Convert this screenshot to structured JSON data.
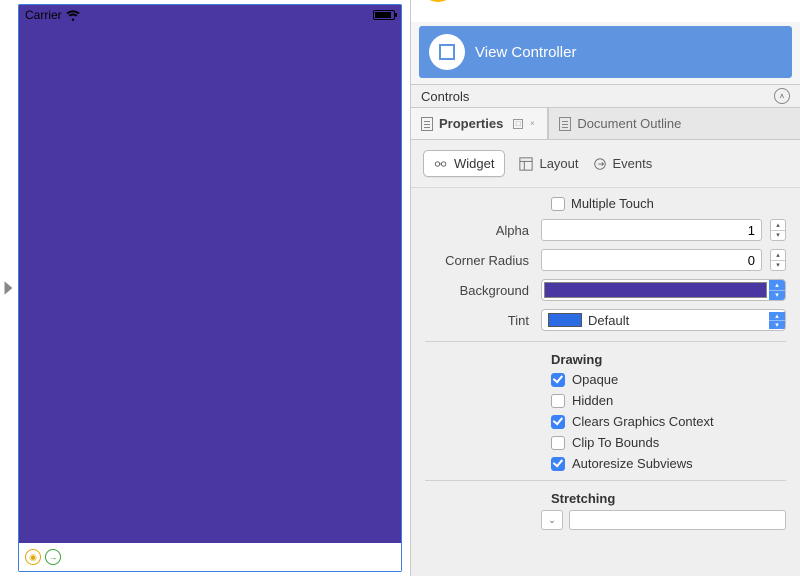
{
  "canvas": {
    "statusbar_carrier": "Carrier",
    "body_color": "#4b37a1"
  },
  "hierarchy": {
    "selected_title": "View Controller"
  },
  "controls_header": "Controls",
  "tabs": {
    "properties": "Properties",
    "outline": "Document Outline"
  },
  "subtabs": {
    "widget": "Widget",
    "layout": "Layout",
    "events": "Events"
  },
  "props": {
    "multiple_touch_label": "Multiple Touch",
    "alpha_label": "Alpha",
    "alpha_value": "1",
    "corner_label": "Corner Radius",
    "corner_value": "0",
    "background_label": "Background",
    "background_color": "#4b37a1",
    "tint_label": "Tint",
    "tint_text": "Default",
    "tint_swatch": "#2b6be4"
  },
  "drawing": {
    "header": "Drawing",
    "opaque": "Opaque",
    "hidden": "Hidden",
    "clears": "Clears Graphics Context",
    "clip": "Clip To Bounds",
    "autoresize": "Autoresize Subviews"
  },
  "stretching": {
    "header": "Stretching"
  }
}
